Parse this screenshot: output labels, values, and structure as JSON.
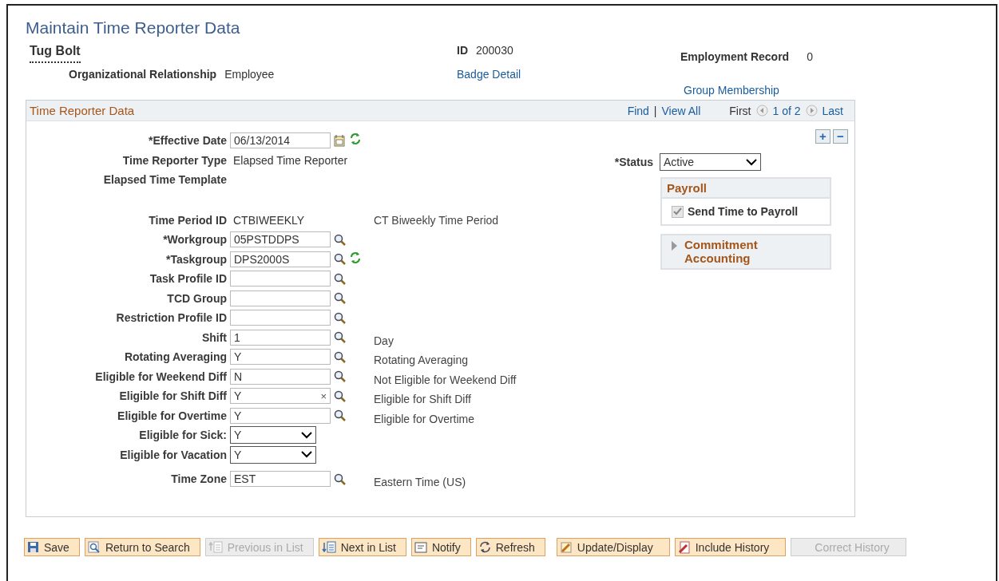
{
  "page": {
    "title": "Maintain Time Reporter Data"
  },
  "header": {
    "name": "Tug Bolt",
    "org_label": "Organizational Relationship",
    "org_value": "Employee",
    "id_label": "ID",
    "id_value": "200030",
    "badge_link": "Badge Detail",
    "record_label": "Employment Record",
    "record_value": "0",
    "group_link": "Group Membership"
  },
  "panel": {
    "title": "Time Reporter Data",
    "find": "Find",
    "separator": "|",
    "view_all": "View All",
    "first": "First",
    "count": "1 of 2",
    "last": "Last",
    "add": "+",
    "remove": "−"
  },
  "field_groups": [
    [
      {
        "kind": "date",
        "label": "*Effective Date",
        "value": "06/13/2014",
        "refresh": true
      },
      {
        "kind": "text",
        "label": "Time Reporter Type",
        "value": "Elapsed Time Reporter"
      },
      {
        "kind": "text",
        "label": "Elapsed Time Template"
      }
    ],
    [
      {
        "kind": "text",
        "label": "Time Period ID",
        "value": "CTBIWEEKLY",
        "description": "CT Biweekly Time Period"
      },
      {
        "kind": "lookup",
        "label": "*Workgroup",
        "value": "05PSTDDPS",
        "refresh": false
      },
      {
        "kind": "lookup",
        "label": "*Taskgroup",
        "value": "DPS2000S",
        "refresh": true
      },
      {
        "kind": "lookup",
        "label": "Task Profile ID",
        "refresh": false
      },
      {
        "kind": "lookup",
        "label": "TCD Group",
        "refresh": false
      },
      {
        "kind": "lookup",
        "label": "Restriction Profile ID",
        "refresh": false
      },
      {
        "kind": "lookup",
        "label": "Shift",
        "value": "1",
        "description": "Day",
        "refresh": false
      },
      {
        "kind": "lookup",
        "label": "Rotating Averaging",
        "value": "Y",
        "description": "Rotating Averaging",
        "refresh": false
      },
      {
        "kind": "lookup",
        "label": "Eligible for Weekend Diff",
        "value": "N",
        "description": "Not Eligible for Weekend Diff",
        "refresh": false
      },
      {
        "kind": "lookup",
        "label": "Eligible for Shift Diff",
        "value": "Y",
        "description": "Eligible for Shift Diff",
        "clear": "×",
        "refresh": false
      },
      {
        "kind": "lookup",
        "label": "Eligible for Overtime",
        "value": "Y",
        "description": "Eligible for Overtime",
        "refresh": false
      },
      {
        "kind": "select",
        "label": "Eligible for Sick:",
        "value": "Y"
      },
      {
        "kind": "select",
        "label": "Eligible for Vacation",
        "value": "Y"
      }
    ],
    [
      {
        "kind": "lookup",
        "label": "Time Zone",
        "value": "EST",
        "description": "Eastern Time (US)",
        "refresh": false
      }
    ]
  ],
  "status": {
    "label": "*Status",
    "value": "Active"
  },
  "payroll": {
    "title": "Payroll",
    "checkbox_label": "Send Time to Payroll",
    "checked": true,
    "disabled": true
  },
  "commitment": {
    "title": "Commitment Accounting",
    "expanded": false
  },
  "buttons": [
    {
      "label": "Save",
      "kind": "save",
      "disabled": false
    },
    {
      "label": "Return to Search",
      "kind": "search",
      "disabled": false
    },
    {
      "label": "Previous in List",
      "kind": "prev",
      "disabled": true
    },
    {
      "label": "Next in List",
      "kind": "next",
      "disabled": false
    },
    {
      "label": "Notify",
      "kind": "notify",
      "disabled": false
    },
    {
      "label": "Refresh",
      "kind": "refresh",
      "disabled": false
    },
    {
      "label": "Update/Display",
      "kind": "update",
      "disabled": false
    },
    {
      "label": "Include History",
      "kind": "history",
      "disabled": false
    },
    {
      "label": "Correct History",
      "kind": "plain",
      "disabled": true
    }
  ]
}
